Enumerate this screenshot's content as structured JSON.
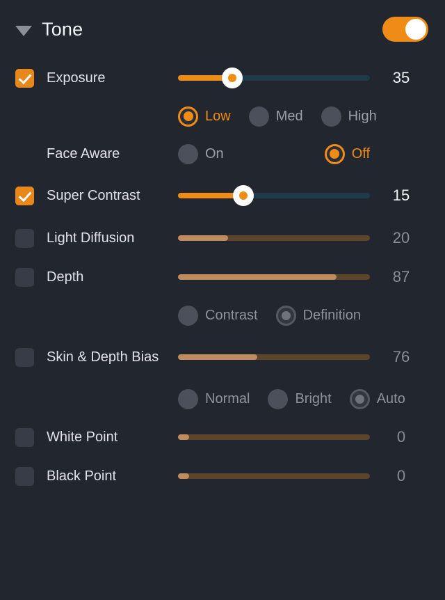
{
  "header": {
    "title": "Tone",
    "disclosure_icon": "triangle-down-icon",
    "toggle_state": "on"
  },
  "rows": {
    "exposure": {
      "label": "Exposure",
      "checked": true,
      "value": "35",
      "options": [
        {
          "label": "Low",
          "selected": true
        },
        {
          "label": "Med",
          "selected": false
        },
        {
          "label": "High",
          "selected": false
        }
      ]
    },
    "face_aware": {
      "label": "Face Aware",
      "options": [
        {
          "label": "On",
          "selected": false
        },
        {
          "label": "Off",
          "selected": true
        }
      ]
    },
    "super_contrast": {
      "label": "Super Contrast",
      "checked": true,
      "value": "15"
    },
    "light_diffusion": {
      "label": "Light Diffusion",
      "checked": false,
      "value": "20"
    },
    "depth": {
      "label": "Depth",
      "checked": false,
      "value": "87",
      "options": [
        {
          "label": "Contrast",
          "selected": false
        },
        {
          "label": "Definition",
          "selected": true
        }
      ]
    },
    "skin_depth_bias": {
      "label": "Skin & Depth Bias",
      "checked": false,
      "value": "76",
      "options": [
        {
          "label": "Normal",
          "selected": false
        },
        {
          "label": "Bright",
          "selected": false
        },
        {
          "label": "Auto",
          "selected": true
        }
      ]
    },
    "white_point": {
      "label": "White Point",
      "checked": false,
      "value": "0"
    },
    "black_point": {
      "label": "Black Point",
      "checked": false,
      "value": "0"
    }
  },
  "colors": {
    "accent": "#ef8c17",
    "background": "#22262f",
    "track_enabled": "#1f3a49",
    "track_disabled": "#5c4528",
    "fill_disabled": "#c08c5e"
  }
}
